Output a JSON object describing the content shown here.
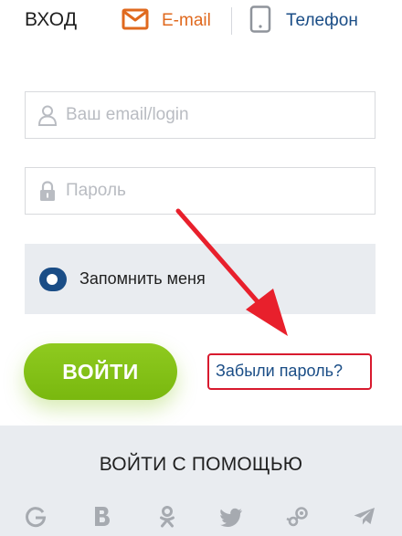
{
  "header": {
    "title": "ВХОД",
    "tabs": [
      {
        "label": "E-mail",
        "icon": "envelope-icon",
        "active": true,
        "color": "#e0691e"
      },
      {
        "label": "Телефон",
        "icon": "phone-icon",
        "active": false,
        "color": "#1a4d86"
      }
    ]
  },
  "form": {
    "email": {
      "placeholder": "Ваш email/login",
      "value": "",
      "icon": "user-icon"
    },
    "password": {
      "placeholder": "Пароль",
      "value": "",
      "icon": "lock-icon"
    },
    "remember": {
      "label": "Запомнить меня",
      "checked": true
    }
  },
  "actions": {
    "login_label": "ВОЙТИ",
    "forgot_label": "Забыли пароль?"
  },
  "social": {
    "title": "ВОЙТИ С ПОМОЩЬЮ",
    "providers": [
      "google-icon",
      "vk-icon",
      "odnoklassniki-icon",
      "twitter-icon",
      "steam-icon",
      "telegram-icon"
    ]
  },
  "colors": {
    "accent_orange": "#e0691e",
    "brand_blue": "#1a4d86",
    "login_green": "#82c016",
    "highlight_red": "#d81a2e",
    "panel_gray": "#e9ecf0"
  }
}
